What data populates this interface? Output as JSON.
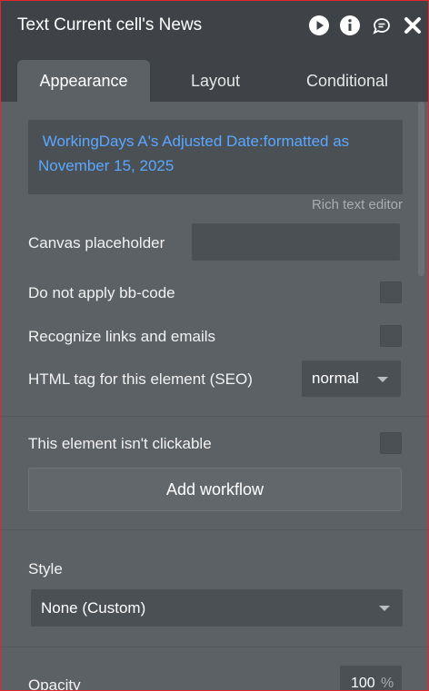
{
  "window": {
    "title": "Text Current cell's News"
  },
  "tabs": [
    {
      "label": "Appearance"
    },
    {
      "label": "Layout"
    },
    {
      "label": "Conditional"
    }
  ],
  "appearance": {
    "text_content": " WorkingDays A's Adjusted Date:formatted as November 15, 2025",
    "rich_text_editor_link": "Rich text editor",
    "canvas_placeholder_label": "Canvas placeholder",
    "canvas_placeholder_value": "",
    "bbcode_label": "Do not apply bb-code",
    "links_label": "Recognize links and emails",
    "html_tag_label": "HTML tag for this element (SEO)",
    "html_tag_value": "normal",
    "not_clickable_label": "This element isn't clickable",
    "add_workflow_label": "Add workflow",
    "style_label": "Style",
    "style_value": "None (Custom)",
    "opacity_label": "Opacity",
    "opacity_value": "100",
    "opacity_unit": "%"
  },
  "colors": {
    "title_bar": "#3f4347",
    "panel": "#5c6166",
    "dynamic_text": "#5ba7ff",
    "border_highlight": "#e2262a"
  },
  "icons": {
    "preview": "play-circle-icon",
    "info": "info-circle-icon",
    "comment": "comment-icon",
    "close": "close-icon"
  }
}
